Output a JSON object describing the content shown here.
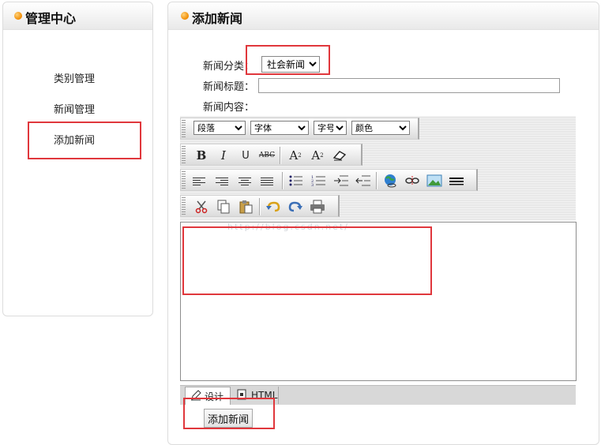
{
  "sidebar": {
    "title": "管理中心",
    "items": [
      {
        "label": "类别管理"
      },
      {
        "label": "新闻管理"
      },
      {
        "label": "添加新闻"
      }
    ]
  },
  "main": {
    "title": "添加新闻",
    "form": {
      "category_label": "新闻分类：",
      "category_value": "社会新闻",
      "title_label": "新闻标题：",
      "title_value": "",
      "content_label": "新闻内容："
    },
    "editor": {
      "format_select": "段落",
      "font_select": "字体",
      "size_select": "字号",
      "color_select": "颜色",
      "bold": "B",
      "italic": "I",
      "underline": "U",
      "strike": "ABC",
      "watermark": "http://blog.csdn.net/",
      "tabs": [
        {
          "label": "设计",
          "active": true
        },
        {
          "label": "HTML",
          "active": false
        }
      ]
    },
    "submit_label": "添加新闻"
  },
  "colors": {
    "accent": "#f08a00",
    "highlight_box": "#e0373c"
  }
}
